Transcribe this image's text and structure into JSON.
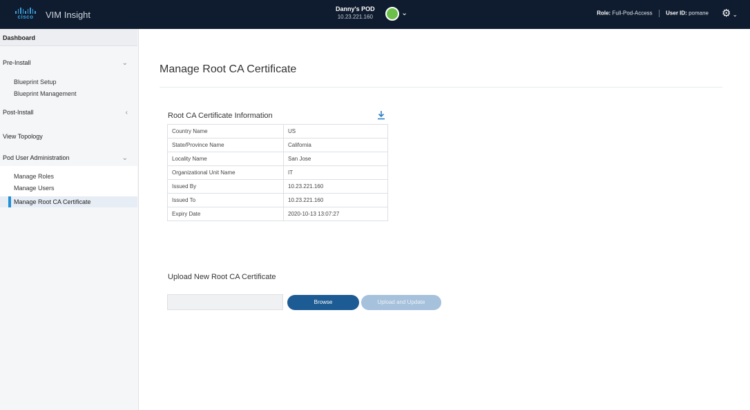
{
  "header": {
    "logo_text": "cisco",
    "app_name": "VIM Insight",
    "pod_name": "Danny's POD",
    "pod_ip": "10.23.221.160",
    "pod_status_color": "#6cc04a",
    "role_label": "Role:",
    "role_value": "Full-Pod-Access",
    "user_label": "User ID:",
    "user_value": "pomane",
    "icons": [
      "cisco-logo",
      "pod-status-icon",
      "chevron-down-icon",
      "gear-icon"
    ]
  },
  "sidebar": {
    "dashboard": "Dashboard",
    "pre_install": {
      "label": "Pre-Install",
      "items": [
        "Blueprint Setup",
        "Blueprint Management"
      ]
    },
    "post_install": {
      "label": "Post-Install"
    },
    "view_topology": "View Topology",
    "pod_user_admin": {
      "label": "Pod User Administration",
      "items": [
        "Manage Roles",
        "Manage Users",
        "Manage Root CA Certificate"
      ]
    },
    "active_color": "#1f8fd6"
  },
  "main": {
    "title": "Manage Root CA Certificate",
    "info_title": "Root CA Certificate Information",
    "info_rows": [
      {
        "key": "Country Name",
        "value": "US"
      },
      {
        "key": "State/Province Name",
        "value": "California"
      },
      {
        "key": "Locality Name",
        "value": "San Jose"
      },
      {
        "key": "Organizational Unit Name",
        "value": "IT"
      },
      {
        "key": "Issued By",
        "value": "10.23.221.160"
      },
      {
        "key": "Issued To",
        "value": "10.23.221.160"
      },
      {
        "key": "Expiry Date",
        "value": "2020-10-13 13:07:27"
      }
    ],
    "upload_title": "Upload New Root CA Certificate",
    "browse_label": "Browse",
    "upload_label": "Upload and Update",
    "file_input_value": ""
  }
}
